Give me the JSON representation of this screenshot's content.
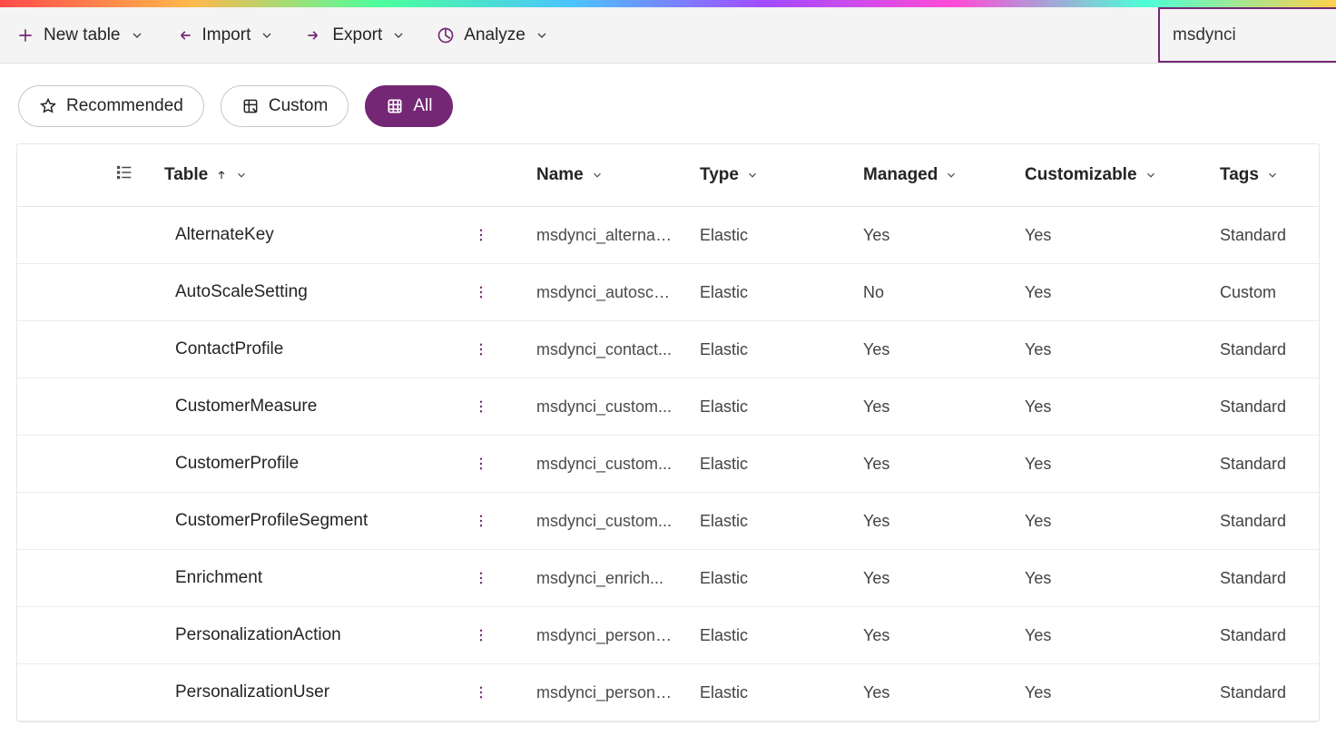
{
  "commandbar": {
    "newTable": "New table",
    "import": "Import",
    "export": "Export",
    "analyze": "Analyze"
  },
  "search": {
    "value": "msdynci"
  },
  "filters": {
    "recommended": "Recommended",
    "custom": "Custom",
    "all": "All"
  },
  "columns": {
    "table": "Table",
    "name": "Name",
    "type": "Type",
    "managed": "Managed",
    "customizable": "Customizable",
    "tags": "Tags"
  },
  "rows": [
    {
      "table": "AlternateKey",
      "name": "msdynci_alternat...",
      "type": "Elastic",
      "managed": "Yes",
      "customizable": "Yes",
      "tags": "Standard"
    },
    {
      "table": "AutoScaleSetting",
      "name": "msdynci_autosca...",
      "type": "Elastic",
      "managed": "No",
      "customizable": "Yes",
      "tags": "Custom"
    },
    {
      "table": "ContactProfile",
      "name": "msdynci_contact...",
      "type": "Elastic",
      "managed": "Yes",
      "customizable": "Yes",
      "tags": "Standard"
    },
    {
      "table": "CustomerMeasure",
      "name": "msdynci_custom...",
      "type": "Elastic",
      "managed": "Yes",
      "customizable": "Yes",
      "tags": "Standard"
    },
    {
      "table": "CustomerProfile",
      "name": "msdynci_custom...",
      "type": "Elastic",
      "managed": "Yes",
      "customizable": "Yes",
      "tags": "Standard"
    },
    {
      "table": "CustomerProfileSegment",
      "name": "msdynci_custom...",
      "type": "Elastic",
      "managed": "Yes",
      "customizable": "Yes",
      "tags": "Standard"
    },
    {
      "table": "Enrichment",
      "name": "msdynci_enrich...",
      "type": "Elastic",
      "managed": "Yes",
      "customizable": "Yes",
      "tags": "Standard"
    },
    {
      "table": "PersonalizationAction",
      "name": "msdynci_persona...",
      "type": "Elastic",
      "managed": "Yes",
      "customizable": "Yes",
      "tags": "Standard"
    },
    {
      "table": "PersonalizationUser",
      "name": "msdynci_persona...",
      "type": "Elastic",
      "managed": "Yes",
      "customizable": "Yes",
      "tags": "Standard"
    }
  ]
}
